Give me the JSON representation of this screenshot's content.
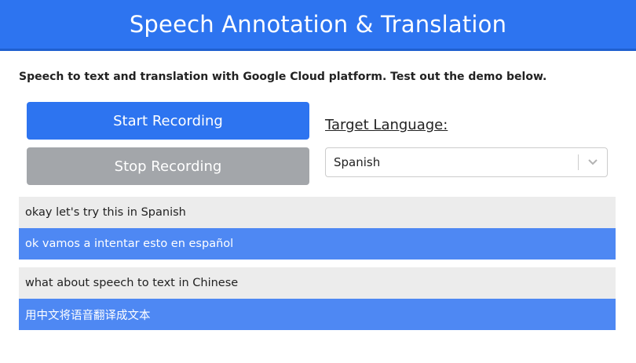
{
  "header": {
    "title": "Speech Annotation & Translation"
  },
  "intro": {
    "text": "Speech to text and translation with Google Cloud platform. Test out the demo below."
  },
  "controls": {
    "start_label": "Start Recording",
    "stop_label": "Stop Recording",
    "target_language_label": "Target Language:",
    "selected_language": "Spanish",
    "dropdown_icon": "chevron-down-icon"
  },
  "transcripts": [
    {
      "source": "okay let's try this in Spanish",
      "translation": "ok vamos a intentar esto en español"
    },
    {
      "source": "what about speech to text in Chinese",
      "translation": "用中文将语音翻译成文本"
    }
  ],
  "colors": {
    "primary": "#2d74f0",
    "disabled": "#a3a6aa",
    "source_row_bg": "#ececec",
    "translation_row_bg": "#4e88f3"
  }
}
